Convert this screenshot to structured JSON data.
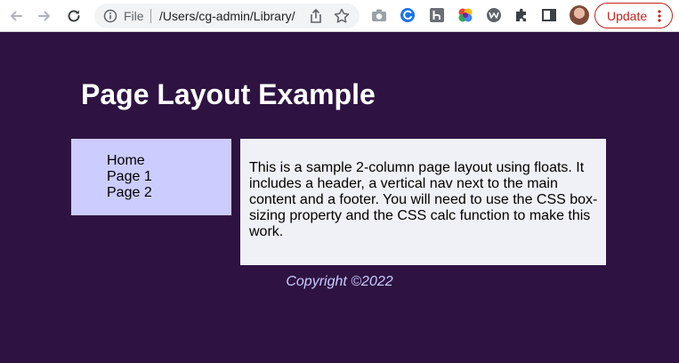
{
  "browser": {
    "file_label": "File",
    "url": "/Users/cg-admin/Library/",
    "update_label": "Update"
  },
  "colors": {
    "background": "#2e1342",
    "nav_background": "#ccccff",
    "content_background": "#f0f0f7",
    "footer_text": "#ccccff",
    "update_accent": "#c5221f"
  },
  "page": {
    "title": "Page Layout Example",
    "nav": {
      "items": [
        "Home",
        "Page 1",
        "Page 2"
      ]
    },
    "main_text": "This is a sample 2-column page layout using floats. It includes a header, a vertical nav next to the main content and a footer. You will need to use the CSS box-sizing property and the CSS calc function to make this work.",
    "footer": "Copyright ©2022"
  },
  "icons": [
    "back-arrow-icon",
    "forward-arrow-icon",
    "reload-icon",
    "info-icon",
    "share-icon",
    "star-icon",
    "camera-icon",
    "extension-blue-circle-icon",
    "extension-h-icon",
    "extension-color-icon",
    "extension-w-icon",
    "puzzle-icon",
    "sidebar-icon",
    "kebab-menu-icon"
  ]
}
